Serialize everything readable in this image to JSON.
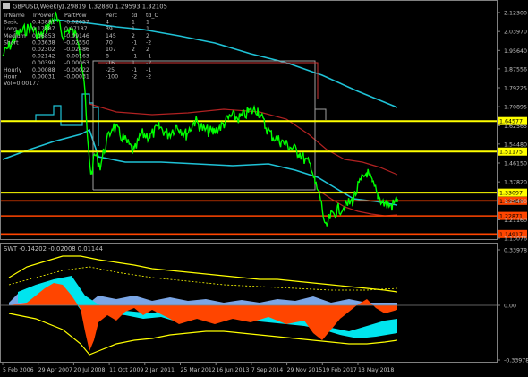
{
  "header": {
    "title": "GBPUSD,Weekly",
    "ohlc": "1.29819 1.32880 1.29593 1.32105"
  },
  "indicator_table": {
    "columns": [
      "TrName",
      "TrPower",
      "PartPow",
      "Perc",
      "td",
      "td_O"
    ],
    "rows": [
      [
        "Basic",
        "0.43881",
        "-0.02057",
        "4",
        "1",
        "1"
      ],
      [
        "Long",
        "0.17887",
        "0.07187",
        "39",
        "1",
        "1"
      ],
      [
        "Medium",
        "0.06853",
        "-0.09146",
        "145",
        "2",
        "2"
      ],
      [
        "Short",
        "0.03638",
        "-0.02550",
        "70",
        "-1",
        "-2"
      ],
      [
        "",
        "0.02302",
        "-0.02486",
        "107",
        "2",
        "2"
      ],
      [
        "",
        "0.02142",
        "-0.00163",
        "8",
        "-1",
        "-1"
      ],
      [
        "",
        "0.00390",
        "-0.00063",
        "-16",
        "1",
        "-2"
      ],
      [
        "Hourly",
        "0.00088",
        "-0.00022",
        "-25",
        "-1",
        "-1"
      ],
      [
        "Hour",
        "0.00031",
        "-0.00031",
        "-100",
        "-2",
        "-2"
      ]
    ],
    "footer": "Vol=0.00177"
  },
  "price_axis": {
    "ticks": [
      "2.12300",
      "2.03970",
      "1.95640",
      "1.87556",
      "1.79225",
      "1.70895",
      "1.62565",
      "1.54480",
      "1.46150",
      "1.37820",
      "1.29490",
      "1.21160",
      "1.13076"
    ]
  },
  "price_levels": [
    {
      "label": "1.64577",
      "color": "#ffff00"
    },
    {
      "label": "1.51175",
      "color": "#ffff00"
    },
    {
      "label": "1.33097",
      "color": "#ffff00"
    },
    {
      "label": "1.29488",
      "color": "#ff4500"
    },
    {
      "label": "1.22871",
      "color": "#ff4500"
    },
    {
      "label": "1.14917",
      "color": "#ff4500"
    }
  ],
  "sub_window": {
    "title": "SWT -0.14202 -0.02008 0.01144",
    "ticks": [
      "0.33978",
      "0.00",
      "-0.33978"
    ]
  },
  "time_axis": {
    "labels": [
      "5 Feb 2006",
      "29 Apr 2007",
      "20 Jul 2008",
      "11 Oct 2009",
      "2 Jan 2011",
      "25 Mar 2012",
      "16 Jun 2013",
      "7 Sep 2014",
      "29 Nov 2015",
      "19 Feb 2017",
      "13 May 2018"
    ]
  },
  "colors": {
    "background": "#000000",
    "price": "#00ff00",
    "level_yellow": "#ffff00",
    "level_red": "#ff4500",
    "ma_aqua": "#1fc2d6",
    "ma_red": "#b22222",
    "sub_orange": "#ff4500",
    "sub_cyan": "#00e5ee",
    "sub_blue": "#7ba6e6",
    "sub_yellow": "#ffff00",
    "axis_text": "#c0c0c0",
    "grid": "#808080"
  }
}
